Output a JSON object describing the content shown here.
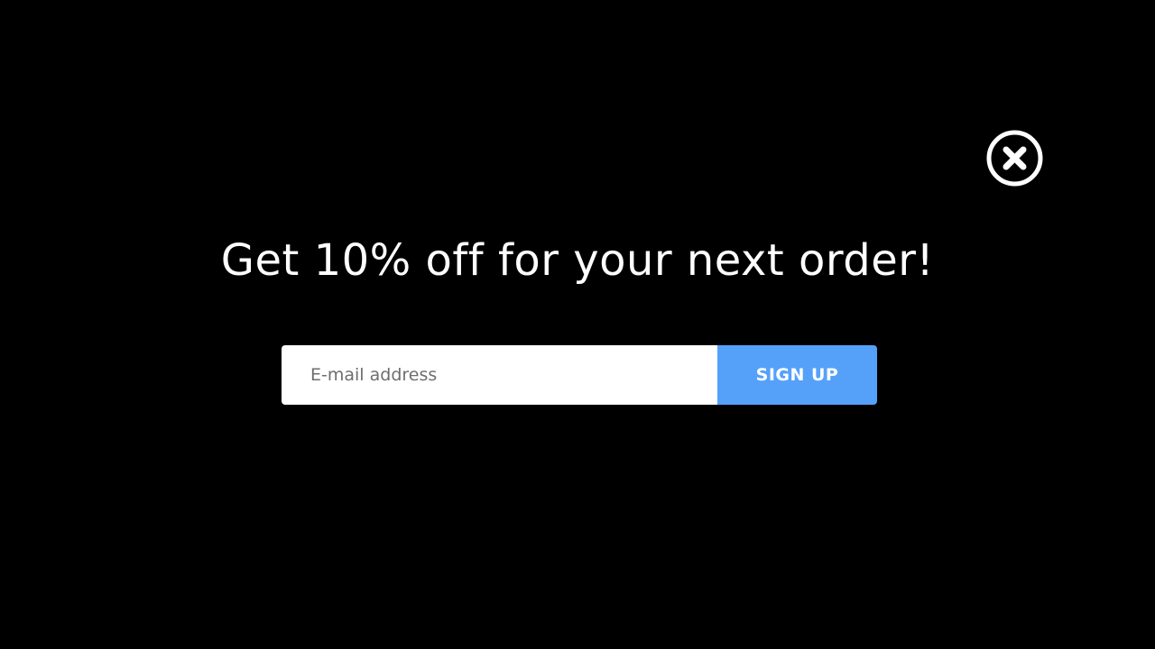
{
  "popup": {
    "close_icon": "close-circle-icon",
    "headline": "Get 10% off for your next order!",
    "email_placeholder": "E-mail address",
    "email_value": "",
    "signup_label": "SIGN UP"
  },
  "colors": {
    "background": "#000000",
    "text": "#ffffff",
    "input_background": "#ffffff",
    "button_background": "#55a1fa"
  }
}
